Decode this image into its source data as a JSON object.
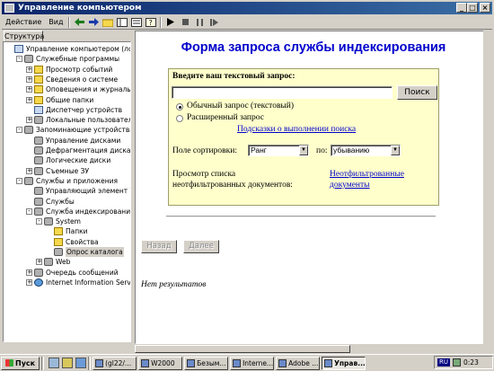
{
  "window": {
    "title": "Управление компьютером"
  },
  "menu": {
    "action": "Действие",
    "view": "Вид"
  },
  "tabs": {
    "structure": "Структура"
  },
  "tree": [
    {
      "text": "Управление компьютером (локальн",
      "indent": 0,
      "pm": "",
      "icon": "comp"
    },
    {
      "text": "Служебные программы",
      "indent": 1,
      "pm": "-",
      "icon": "gear"
    },
    {
      "text": "Просмотр событий",
      "indent": 2,
      "pm": "+",
      "icon": "fold"
    },
    {
      "text": "Сведения о системе",
      "indent": 2,
      "pm": "+",
      "icon": "fold"
    },
    {
      "text": "Оповещения и журналы про",
      "indent": 2,
      "pm": "+",
      "icon": "fold"
    },
    {
      "text": "Общие папки",
      "indent": 2,
      "pm": "+",
      "icon": "fold"
    },
    {
      "text": "Диспетчер устройств",
      "indent": 2,
      "pm": "",
      "icon": "comp"
    },
    {
      "text": "Локальные пользователи и г",
      "indent": 2,
      "pm": "+",
      "icon": "gear"
    },
    {
      "text": "Запоминающие устройства",
      "indent": 1,
      "pm": "-",
      "icon": "gear"
    },
    {
      "text": "Управление дисками",
      "indent": 2,
      "pm": "",
      "icon": "gear"
    },
    {
      "text": "Дефрагментация диска",
      "indent": 2,
      "pm": "",
      "icon": "gear"
    },
    {
      "text": "Логические диски",
      "indent": 2,
      "pm": "",
      "icon": "gear"
    },
    {
      "text": "Съемные ЗУ",
      "indent": 2,
      "pm": "+",
      "icon": "gear"
    },
    {
      "text": "Службы и приложения",
      "indent": 1,
      "pm": "-",
      "icon": "gear"
    },
    {
      "text": "Управляющий элемент WMI",
      "indent": 2,
      "pm": "",
      "icon": "gear"
    },
    {
      "text": "Службы",
      "indent": 2,
      "pm": "",
      "icon": "gear"
    },
    {
      "text": "Служба индексирования",
      "indent": 2,
      "pm": "-",
      "icon": "gear"
    },
    {
      "text": "System",
      "indent": 3,
      "pm": "-",
      "icon": "gear"
    },
    {
      "text": "Папки",
      "indent": 4,
      "pm": "",
      "icon": "fold"
    },
    {
      "text": "Свойства",
      "indent": 4,
      "pm": "",
      "icon": "fold"
    },
    {
      "text": "Опрос каталога",
      "indent": 4,
      "pm": "",
      "icon": "gear",
      "selected": true
    },
    {
      "text": "Web",
      "indent": 3,
      "pm": "+",
      "icon": "gear"
    },
    {
      "text": "Очередь сообщений",
      "indent": 2,
      "pm": "+",
      "icon": "gear"
    },
    {
      "text": "Internet Information Services",
      "indent": 2,
      "pm": "+",
      "icon": "net"
    }
  ],
  "content": {
    "title": "Форма запроса службы индексирования",
    "query_label": "Введите ваш текстовый запрос:",
    "query_value": "",
    "search_button": "Поиск",
    "radio_simple": "Обычный запрос (текстовый)",
    "radio_advanced": "Расширенный запрос",
    "hints_link": "Подсказки о выполнении поиска",
    "sort_label": "Поле сортировки:",
    "sort_field": "Ранг",
    "sort_by_label": "по:",
    "sort_order": "убыванию",
    "unfiltered_label_1": "Просмотр списка",
    "unfiltered_label_2": "неотфильтрованных документов:",
    "unfiltered_link_1": "Неотфильтрованные",
    "unfiltered_link_2": "документы",
    "back_button": "Назад",
    "next_button": "Далее",
    "no_results": "Нет результатов"
  },
  "taskbar": {
    "start": "Пуск",
    "tasks": [
      "(gl22/...",
      "W2000",
      "Безым...",
      "Interne...",
      "Adobe ...",
      "Управ..."
    ],
    "lang": "RU",
    "clock": "0:23"
  }
}
